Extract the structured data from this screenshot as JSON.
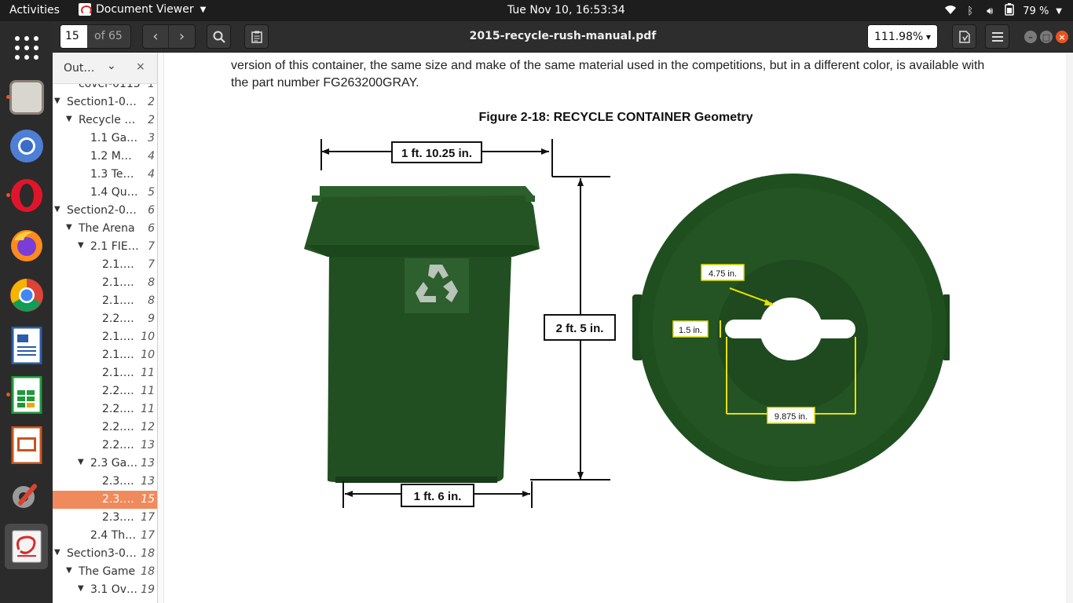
{
  "topbar": {
    "activities": "Activities",
    "app_name": "Document Viewer",
    "clock": "Tue Nov 10, 16:53:34",
    "battery": "79 %"
  },
  "dock": {
    "items": [
      "files-icon",
      "chromium-icon",
      "opera-icon",
      "firefox-icon",
      "chrome-icon",
      "writer-icon",
      "calc-icon",
      "impress-icon",
      "settings-icon",
      "document-viewer-icon"
    ]
  },
  "header": {
    "page_number": "15",
    "page_total": "of 65",
    "doc_title": "2015-recycle-rush-manual.pdf",
    "zoom": "111.98%"
  },
  "sidebar": {
    "title": "Out…",
    "outline": [
      {
        "label": "cover-0113",
        "page": "1",
        "level": 1,
        "toggle": "none"
      },
      {
        "label": "Section1-0…",
        "page": "2",
        "level": 0,
        "toggle": "open"
      },
      {
        "label": "Recycle …",
        "page": "2",
        "level": 1,
        "toggle": "open"
      },
      {
        "label": "1.1 Ga…",
        "page": "3",
        "level": 2,
        "toggle": "none"
      },
      {
        "label": "1.2 M…",
        "page": "4",
        "level": 2,
        "toggle": "none"
      },
      {
        "label": "1.3 Te…",
        "page": "4",
        "level": 2,
        "toggle": "none"
      },
      {
        "label": "1.4 Qu…",
        "page": "5",
        "level": 2,
        "toggle": "none"
      },
      {
        "label": "Section2-0…",
        "page": "6",
        "level": 0,
        "toggle": "open"
      },
      {
        "label": "The Arena",
        "page": "6",
        "level": 1,
        "toggle": "open"
      },
      {
        "label": "2.1 FIE…",
        "page": "7",
        "level": 2,
        "toggle": "open"
      },
      {
        "label": "2.1.…",
        "page": "7",
        "level": 3,
        "toggle": "none"
      },
      {
        "label": "2.1.…",
        "page": "8",
        "level": 3,
        "toggle": "none"
      },
      {
        "label": "2.1.…",
        "page": "8",
        "level": 3,
        "toggle": "none"
      },
      {
        "label": "2.2.…",
        "page": "9",
        "level": 3,
        "toggle": "none"
      },
      {
        "label": "2.1.…",
        "page": "10",
        "level": 3,
        "toggle": "none"
      },
      {
        "label": "2.1.…",
        "page": "10",
        "level": 3,
        "toggle": "none"
      },
      {
        "label": "2.1.…",
        "page": "11",
        "level": 3,
        "toggle": "none"
      },
      {
        "label": "2.2.…",
        "page": "11",
        "level": 3,
        "toggle": "none"
      },
      {
        "label": "2.2.…",
        "page": "11",
        "level": 3,
        "toggle": "none"
      },
      {
        "label": "2.2.…",
        "page": "12",
        "level": 3,
        "toggle": "none"
      },
      {
        "label": "2.2.…",
        "page": "13",
        "level": 3,
        "toggle": "none"
      },
      {
        "label": "2.3 Ga…",
        "page": "13",
        "level": 2,
        "toggle": "open"
      },
      {
        "label": "2.3.…",
        "page": "13",
        "level": 3,
        "toggle": "none"
      },
      {
        "label": "2.3.…",
        "page": "15",
        "level": 3,
        "toggle": "none",
        "selected": true
      },
      {
        "label": "2.3.…",
        "page": "17",
        "level": 3,
        "toggle": "none"
      },
      {
        "label": "2.4 Th…",
        "page": "17",
        "level": 2,
        "toggle": "none"
      },
      {
        "label": "Section3-0…",
        "page": "18",
        "level": 0,
        "toggle": "open"
      },
      {
        "label": "The Game",
        "page": "18",
        "level": 1,
        "toggle": "open"
      },
      {
        "label": "3.1 Ov…",
        "page": "19",
        "level": 2,
        "toggle": "open"
      }
    ]
  },
  "document": {
    "line1": "version of this container, the same size and make of the same material used in the competitions, but in a different color, is available with",
    "line2": "the part number FG263200GRAY.",
    "figure_caption": "Figure 2-18: RECYCLE CONTAINER Geometry",
    "dims": {
      "top_width": "1 ft. 10.25 in.",
      "height": "2 ft. 5 in.",
      "bottom_width": "1 ft. 6 in.",
      "hole_offset": "4.75 in.",
      "slot_height": "1.5 in.",
      "slot_width": "9.875 in."
    }
  },
  "colors": {
    "container_green": "#1f4f1f",
    "accent": "#e95420",
    "dim_yellow": "#e8e000"
  }
}
